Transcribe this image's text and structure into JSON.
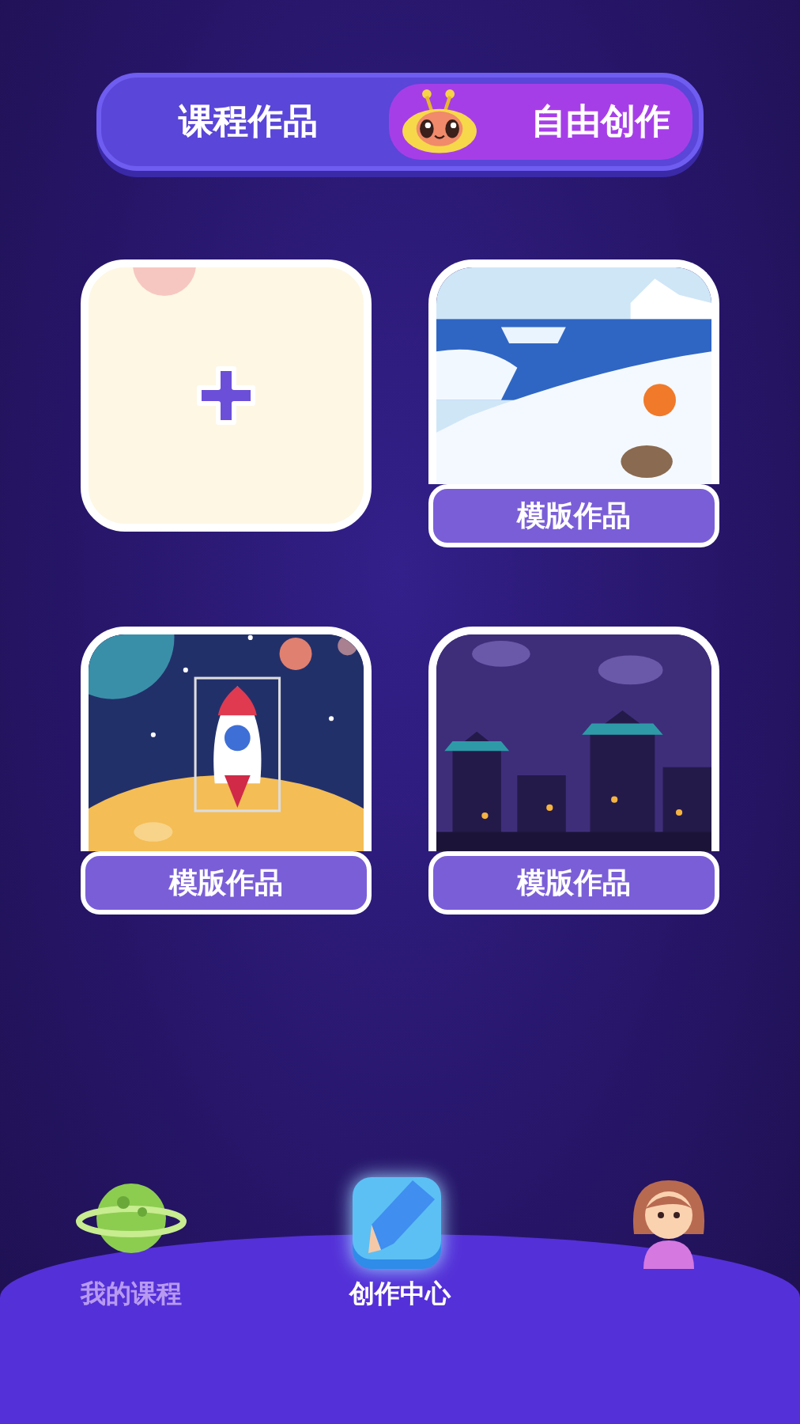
{
  "tabs": [
    {
      "label": "课程作品",
      "selected": false
    },
    {
      "label": "自由创作",
      "selected": true
    }
  ],
  "works": [
    {
      "kind": "new"
    },
    {
      "kind": "template",
      "label": "模版作品"
    },
    {
      "kind": "template",
      "label": "模版作品"
    },
    {
      "kind": "template",
      "label": "模版作品"
    }
  ],
  "nav": [
    {
      "label": "我的课程",
      "selected": false
    },
    {
      "label": "创作中心",
      "selected": true
    },
    {
      "selected": false
    }
  ]
}
